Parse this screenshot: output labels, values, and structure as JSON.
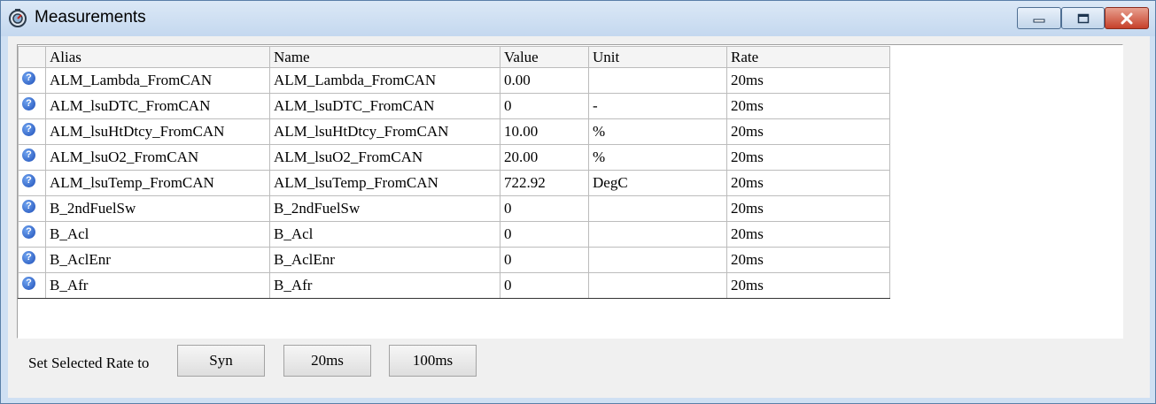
{
  "window": {
    "title": "Measurements",
    "icon": "gauge-icon"
  },
  "grid": {
    "columns": [
      "Alias",
      "Name",
      "Value",
      "Unit",
      "Rate"
    ],
    "row_icon": "question-icon",
    "rows": [
      {
        "alias": "ALM_Lambda_FromCAN",
        "name": "ALM_Lambda_FromCAN",
        "value": "0.00",
        "unit": "",
        "rate": "20ms"
      },
      {
        "alias": "ALM_lsuDTC_FromCAN",
        "name": "ALM_lsuDTC_FromCAN",
        "value": "0",
        "unit": "-",
        "rate": "20ms"
      },
      {
        "alias": "ALM_lsuHtDtcy_FromCAN",
        "name": "ALM_lsuHtDtcy_FromCAN",
        "value": "10.00",
        "unit": "%",
        "rate": "20ms"
      },
      {
        "alias": "ALM_lsuO2_FromCAN",
        "name": "ALM_lsuO2_FromCAN",
        "value": "20.00",
        "unit": "%",
        "rate": "20ms"
      },
      {
        "alias": "ALM_lsuTemp_FromCAN",
        "name": "ALM_lsuTemp_FromCAN",
        "value": "722.92",
        "unit": "DegC",
        "rate": "20ms"
      },
      {
        "alias": "B_2ndFuelSw",
        "name": "B_2ndFuelSw",
        "value": "0",
        "unit": "",
        "rate": "20ms"
      },
      {
        "alias": "B_Acl",
        "name": "B_Acl",
        "value": "0",
        "unit": "",
        "rate": "20ms"
      },
      {
        "alias": "B_AclEnr",
        "name": "B_AclEnr",
        "value": "0",
        "unit": "",
        "rate": "20ms"
      },
      {
        "alias": "B_Afr",
        "name": "B_Afr",
        "value": "0",
        "unit": "",
        "rate": "20ms"
      }
    ]
  },
  "rate_bar": {
    "label": "Set Selected Rate to",
    "buttons": [
      "Syn",
      "20ms",
      "100ms"
    ]
  }
}
